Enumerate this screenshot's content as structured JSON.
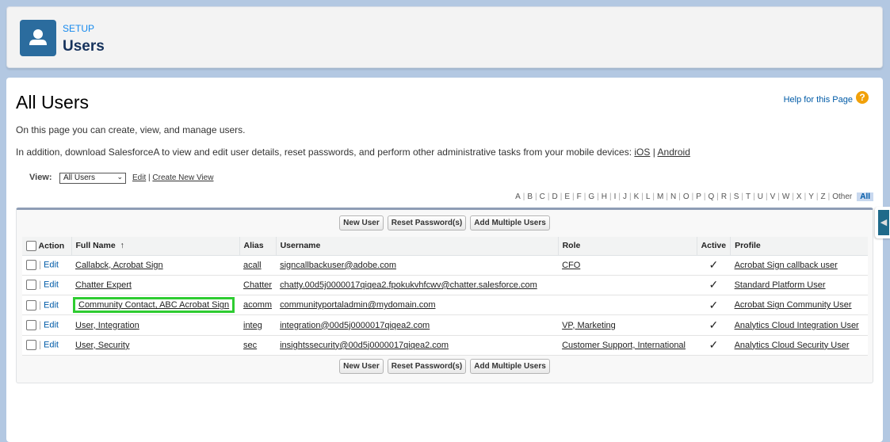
{
  "header": {
    "section": "SETUP",
    "title": "Users",
    "icon": "user-icon"
  },
  "page": {
    "title": "All Users",
    "help": "Help for this Page",
    "intro": "On this page you can create, view, and manage users.",
    "mobile_text": "In addition, download SalesforceA to view and edit user details, reset passwords, and perform other administrative tasks from your mobile devices: ",
    "ios": "iOS",
    "sep": " | ",
    "android": "Android"
  },
  "view": {
    "label": "View:",
    "selected": "All Users",
    "edit": "Edit",
    "create": "Create New View",
    "sep": " | "
  },
  "alpha": [
    "A",
    "B",
    "C",
    "D",
    "E",
    "F",
    "G",
    "H",
    "I",
    "J",
    "K",
    "L",
    "M",
    "N",
    "O",
    "P",
    "Q",
    "R",
    "S",
    "T",
    "U",
    "V",
    "W",
    "X",
    "Y",
    "Z",
    "Other"
  ],
  "alpha_all": "All",
  "buttons": {
    "new_user": "New User",
    "reset": "Reset Password(s)",
    "add_multiple": "Add Multiple Users"
  },
  "columns": {
    "action": "Action",
    "full_name": "Full Name",
    "sort": "↑",
    "alias": "Alias",
    "username": "Username",
    "role": "Role",
    "active": "Active",
    "profile": "Profile"
  },
  "edit_label": "Edit",
  "rows": [
    {
      "name": "Callabck, Acrobat Sign",
      "alias": "acall",
      "username": "signcallbackuser@adobe.com",
      "role": "CFO",
      "active": "✓",
      "profile": "Acrobat Sign callback user"
    },
    {
      "name": "Chatter Expert",
      "alias": "Chatter",
      "username": "chatty.00d5j0000017qiqea2.fpokukvhfcwv@chatter.salesforce.com",
      "role": "",
      "active": "✓",
      "profile": "Standard Platform User"
    },
    {
      "name": "Community Contact, ABC Acrobat Sign",
      "alias": "acomm",
      "username": "communityportaladmin@mydomain.com",
      "role": "",
      "active": "✓",
      "profile": "Acrobat Sign Community User"
    },
    {
      "name": "User, Integration",
      "alias": "integ",
      "username": "integration@00d5j0000017qiqea2.com",
      "role": "VP, Marketing",
      "active": "✓",
      "profile": "Analytics Cloud Integration User"
    },
    {
      "name": "User, Security",
      "alias": "sec",
      "username": "insightssecurity@00d5j0000017qiqea2.com",
      "role": "Customer Support, International",
      "active": "✓",
      "profile": "Analytics Cloud Security User"
    }
  ],
  "highlight_color": "#2ecc31"
}
